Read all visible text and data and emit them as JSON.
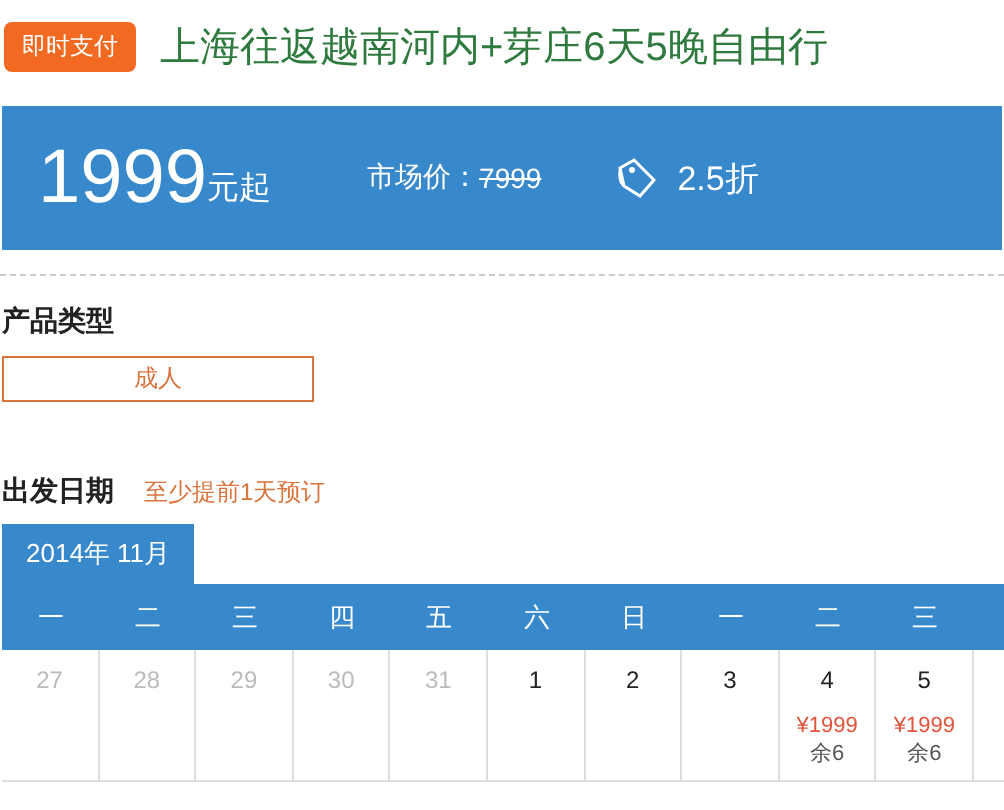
{
  "header": {
    "badge": "即时支付",
    "title": "上海往返越南河内+芽庄6天5晚自由行"
  },
  "price_bar": {
    "price": "1999",
    "price_suffix": "元起",
    "market_label": "市场价：",
    "market_price": "7999",
    "discount": "2.5折"
  },
  "product_type": {
    "heading": "产品类型",
    "options": [
      {
        "label": "成人",
        "selected": true
      }
    ]
  },
  "departure": {
    "heading": "出发日期",
    "note": "至少提前1天预订",
    "month_tabs": [
      {
        "label": "2014年 11月",
        "selected": true
      }
    ],
    "weekdays": [
      "一",
      "二",
      "三",
      "四",
      "五",
      "六",
      "日",
      "一",
      "二",
      "三"
    ],
    "days": [
      {
        "day": "27",
        "in_month": false
      },
      {
        "day": "28",
        "in_month": false
      },
      {
        "day": "29",
        "in_month": false
      },
      {
        "day": "30",
        "in_month": false
      },
      {
        "day": "31",
        "in_month": false
      },
      {
        "day": "1",
        "in_month": true
      },
      {
        "day": "2",
        "in_month": true
      },
      {
        "day": "3",
        "in_month": true
      },
      {
        "day": "4",
        "in_month": true,
        "price": "¥1999",
        "stock": "余6"
      },
      {
        "day": "5",
        "in_month": true,
        "price": "¥1999",
        "stock": "余6"
      }
    ]
  }
}
